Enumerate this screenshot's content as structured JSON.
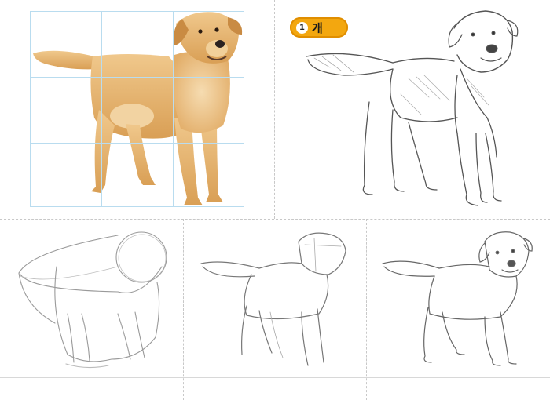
{
  "badge": {
    "number": "1",
    "title": "개"
  },
  "colors": {
    "badge_fill": "#f3a70f",
    "grid_line": "#b9dcef",
    "fur": "#e8b978",
    "pencil": "#555555"
  },
  "panels": [
    {
      "name": "reference-photo",
      "icon": "dog-photo"
    },
    {
      "name": "finished-sketch",
      "icon": "dog-pencil-sketch"
    },
    {
      "name": "step-1-shapes",
      "icon": "dog-construction-sketch"
    },
    {
      "name": "step-2-outline",
      "icon": "dog-outline-sketch"
    },
    {
      "name": "step-3-details",
      "icon": "dog-detailed-sketch"
    }
  ]
}
